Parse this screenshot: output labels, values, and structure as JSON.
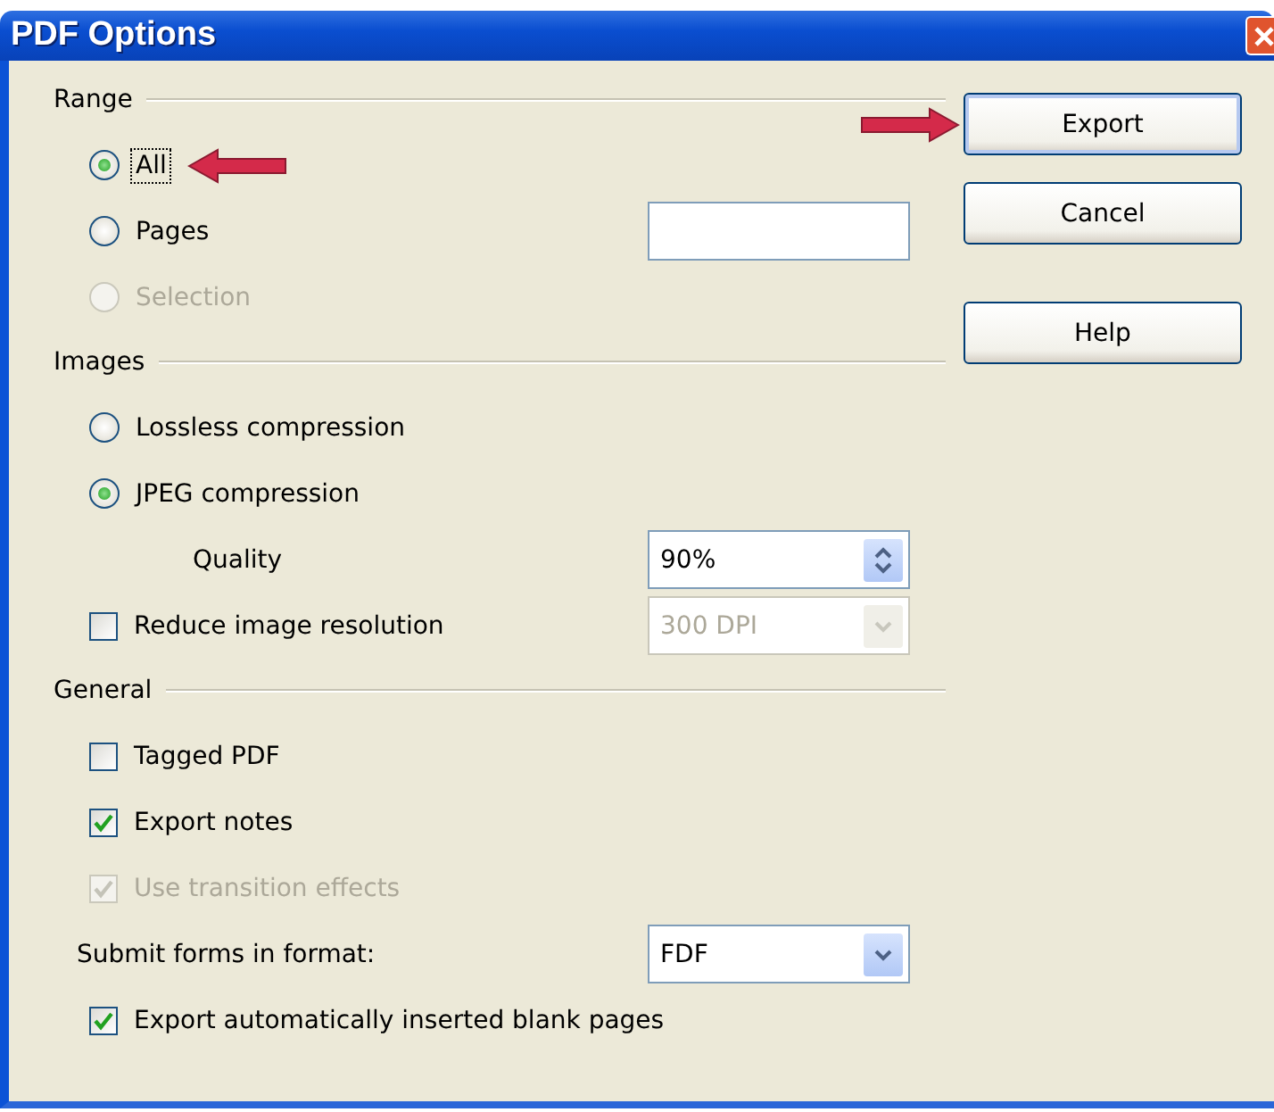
{
  "window": {
    "title": "PDF Options"
  },
  "sections": [
    {
      "title": "Range",
      "items": [
        {
          "kind": "radio",
          "label": "All",
          "selected": true,
          "disabled": false,
          "focused": true,
          "arrow": true
        },
        {
          "kind": "radio",
          "label": "Pages",
          "selected": false,
          "disabled": false,
          "focused": false,
          "arrow": false,
          "control": {
            "kind": "text_field",
            "disabled": false
          }
        },
        {
          "kind": "radio",
          "label": "Selection",
          "selected": false,
          "disabled": true,
          "focused": false,
          "arrow": false
        }
      ]
    },
    {
      "title": "Images",
      "items": [
        {
          "kind": "radio",
          "label": "Lossless compression",
          "selected": false,
          "disabled": false,
          "focused": false,
          "arrow": false
        },
        {
          "kind": "radio",
          "label": "JPEG compression",
          "selected": true,
          "disabled": false,
          "focused": false,
          "arrow": false,
          "children": [
            {
              "kind": "label",
              "label": "Quality",
              "disabled": false,
              "focused": false,
              "arrow": false,
              "control": {
                "kind": "spin",
                "value": "90%",
                "disabled": false
              }
            }
          ]
        },
        {
          "kind": "checkbox",
          "label": "Reduce image resolution",
          "checked": false,
          "disabled": false,
          "focused": false,
          "arrow": false,
          "control": {
            "kind": "dropdown",
            "value": "300 DPI",
            "disabled": true
          }
        }
      ]
    },
    {
      "title": "General",
      "items": [
        {
          "kind": "checkbox",
          "label": "Tagged PDF",
          "checked": false,
          "disabled": false,
          "focused": false,
          "arrow": false
        },
        {
          "kind": "checkbox",
          "label": "Export notes",
          "checked": true,
          "disabled": false,
          "focused": false,
          "arrow": false
        },
        {
          "kind": "checkbox",
          "label": "Use transition effects",
          "checked": true,
          "disabled": true,
          "focused": false,
          "arrow": false
        },
        {
          "kind": "label",
          "label": "Submit forms in format:",
          "disabled": false,
          "focused": false,
          "arrow": false,
          "control": {
            "kind": "dropdown",
            "value": "FDF",
            "disabled": false
          }
        },
        {
          "kind": "checkbox",
          "label": "Export automatically inserted blank pages",
          "checked": true,
          "disabled": false,
          "focused": false,
          "arrow": false
        }
      ]
    }
  ],
  "buttons": [
    {
      "label": "Export",
      "default": true,
      "arrow": true
    },
    {
      "label": "Cancel",
      "default": false,
      "arrow": false
    },
    {
      "label": "Help",
      "default": false,
      "arrow": false
    }
  ]
}
